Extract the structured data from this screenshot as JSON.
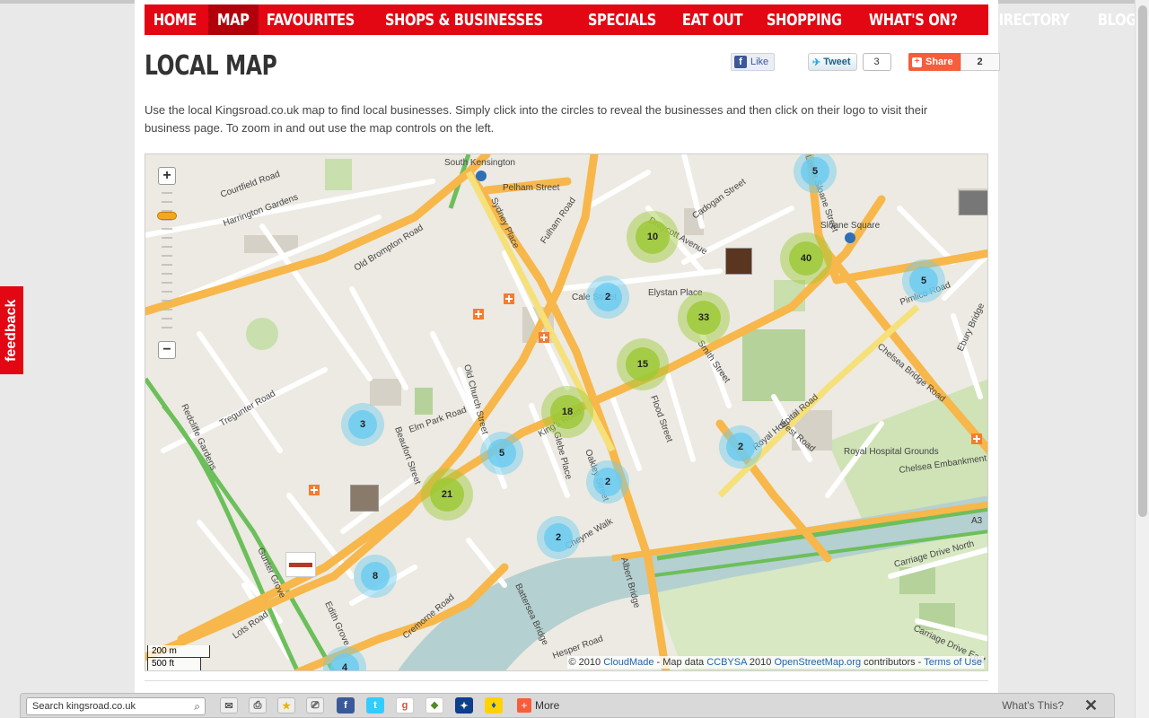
{
  "nav": {
    "items": [
      {
        "label": "HOME",
        "active": false
      },
      {
        "label": "MAP",
        "active": true
      },
      {
        "label": "FAVOURITES",
        "active": false
      },
      {
        "label": "SHOPS & BUSINESSES",
        "active": false
      },
      {
        "label": "SPECIALS",
        "active": false
      },
      {
        "label": "EAT OUT",
        "active": false
      },
      {
        "label": "SHOPPING",
        "active": false
      },
      {
        "label": "WHAT'S ON?",
        "active": false
      },
      {
        "label": "DIRECTORY",
        "active": false
      },
      {
        "label": "BLOG",
        "active": false
      }
    ]
  },
  "page": {
    "title": "LOCAL MAP",
    "intro": "Use the local Kingsroad.co.uk map to find local businesses. Simply click into the circles to reveal the businesses and then click on their logo to visit their business page. To zoom in and out use the map controls on the left."
  },
  "social": {
    "like_label": "Like",
    "tweet_label": "Tweet",
    "tweet_count": "3",
    "share_label": "Share",
    "share_count": "2"
  },
  "map": {
    "zoom_in": "+",
    "zoom_out": "−",
    "scale_metric": "200 m",
    "scale_imperial": "500 ft",
    "attribution": {
      "prefix": "© 2010",
      "cloudmade": "CloudMade",
      "mapdata": "- Map data",
      "ccbysa": "CCBYSA",
      "year": "2010",
      "osm": "OpenStreetMap.org",
      "contributors": "contributors -",
      "terms": "Terms of Use"
    },
    "labels": [
      "South Kensington",
      "Pelham Street",
      "Sloane Square",
      "Courtfield Road",
      "Harrington Gardens",
      "Old Brompton Road",
      "Fulham Road",
      "Sydney Place",
      "Cale Street",
      "Elystan Place",
      "Draycott Avenue",
      "Cadogan Street",
      "King's Road",
      "Royal Hospital Road",
      "Royal Hospital Grounds",
      "Chelsea Embankment",
      "Chelsea Bridge Road",
      "Pimlico Road",
      "Cheyne Walk",
      "Albert Bridge",
      "Battersea Bridge",
      "Carriage Drive North",
      "Carriage Drive East",
      "Redcliffe Gardens",
      "Edith Grove",
      "Ebury Bridge",
      "Cremorne Road",
      "Oakley Street",
      "Old Church Street",
      "Beaufort Street",
      "Hesper Road",
      "Lots Road",
      "Gunter Grove",
      "Tregunter Road",
      "Elm Park Road",
      "Glebe Place",
      "Smith Street",
      "Flood Street",
      "Lower Sloane Street",
      "West Road"
    ],
    "clusters": [
      {
        "count": "5",
        "color": "blue"
      },
      {
        "count": "10",
        "color": "green"
      },
      {
        "count": "40",
        "color": "green"
      },
      {
        "count": "5",
        "color": "blue"
      },
      {
        "count": "2",
        "color": "blue"
      },
      {
        "count": "33",
        "color": "green"
      },
      {
        "count": "15",
        "color": "green"
      },
      {
        "count": "18",
        "color": "green"
      },
      {
        "count": "3",
        "color": "blue"
      },
      {
        "count": "5",
        "color": "blue"
      },
      {
        "count": "2",
        "color": "blue"
      },
      {
        "count": "2",
        "color": "blue"
      },
      {
        "count": "21",
        "color": "green"
      },
      {
        "count": "2",
        "color": "blue"
      },
      {
        "count": "8",
        "color": "blue"
      },
      {
        "count": "4",
        "color": "blue"
      }
    ]
  },
  "feedback": "feedback",
  "toolbar": {
    "search_placeholder": "Search kingsroad.co.uk",
    "more_label": "More",
    "whats_this": "What's This?",
    "close": "✕"
  }
}
